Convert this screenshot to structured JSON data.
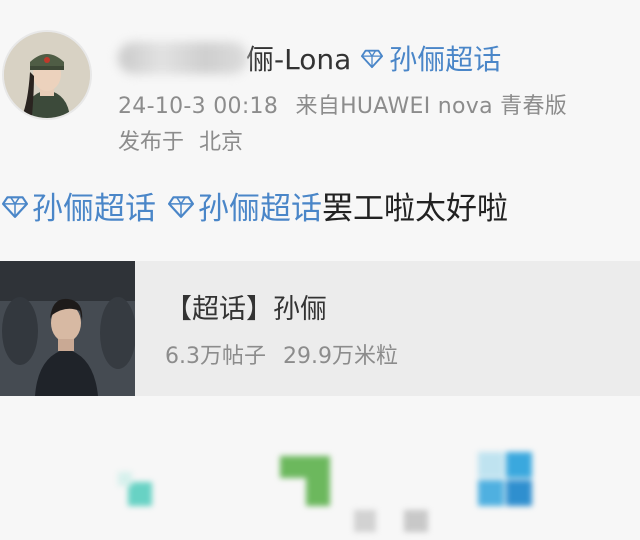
{
  "post": {
    "author": {
      "name_suffix": "俪-Lona",
      "super_topic": "孙俪超话"
    },
    "meta": {
      "timestamp": "24-10-3 00:18",
      "source_prefix": "来自",
      "device": "HUAWEI nova 青春版",
      "location_prefix": "发布于",
      "location": "北京"
    },
    "body": {
      "tags": [
        "孙俪超话",
        "孙俪超话"
      ],
      "text": "罢工啦太好啦"
    }
  },
  "card": {
    "title": "【超话】孙俪",
    "posts": "6.3万帖子",
    "points": "29.9万米粒"
  },
  "colors": {
    "link": "#4a86c8",
    "meta": "#8c8c8c",
    "card_bg": "#ececec"
  },
  "icons": [
    "diamond-icon",
    "repost-icon",
    "comment-icon",
    "like-icon"
  ]
}
